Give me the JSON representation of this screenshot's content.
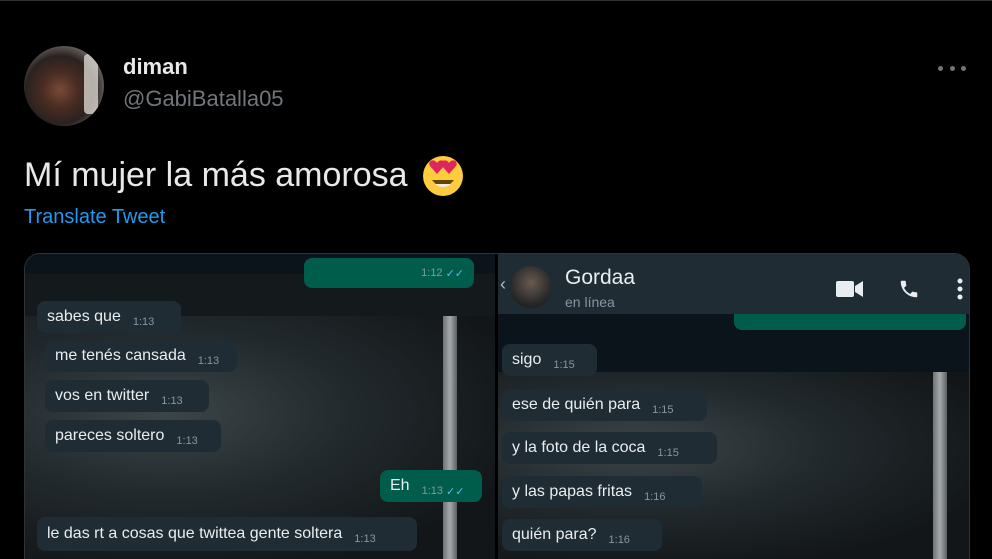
{
  "author": {
    "display_name": "diman",
    "handle": "@GabiBatalla05"
  },
  "tweet": {
    "text": "Mí mujer la más amorosa",
    "emoji": "heart-eyes-emoji",
    "translate_label": "Translate Tweet"
  },
  "colors": {
    "link": "#1d9bf0",
    "wa_in": "#1f2c33",
    "wa_out": "#005c4b",
    "ticks": "#53bdeb"
  },
  "left_chat": {
    "top_out": {
      "text": "",
      "time": "1:12"
    },
    "messages": [
      {
        "text": "sabes que",
        "time": "1:13"
      },
      {
        "text": "me tenés cansada",
        "time": "1:13"
      },
      {
        "text": "vos en twitter",
        "time": "1:13"
      },
      {
        "text": "pareces soltero",
        "time": "1:13"
      }
    ],
    "reply": {
      "text": "Eh",
      "time": "1:13"
    },
    "last": {
      "text": "le das rt a cosas que twittea gente soltera",
      "time": "1:13"
    }
  },
  "right_chat": {
    "contact": {
      "name": "Gordaa",
      "status": "en línea"
    },
    "messages": [
      {
        "text": "sigo",
        "time": "1:15"
      },
      {
        "text": "ese de quién para",
        "time": "1:15"
      },
      {
        "text": "y la foto de la coca",
        "time": "1:15"
      },
      {
        "text": "y las papas fritas",
        "time": "1:16"
      },
      {
        "text": "quién para?",
        "time": "1:16"
      }
    ]
  }
}
